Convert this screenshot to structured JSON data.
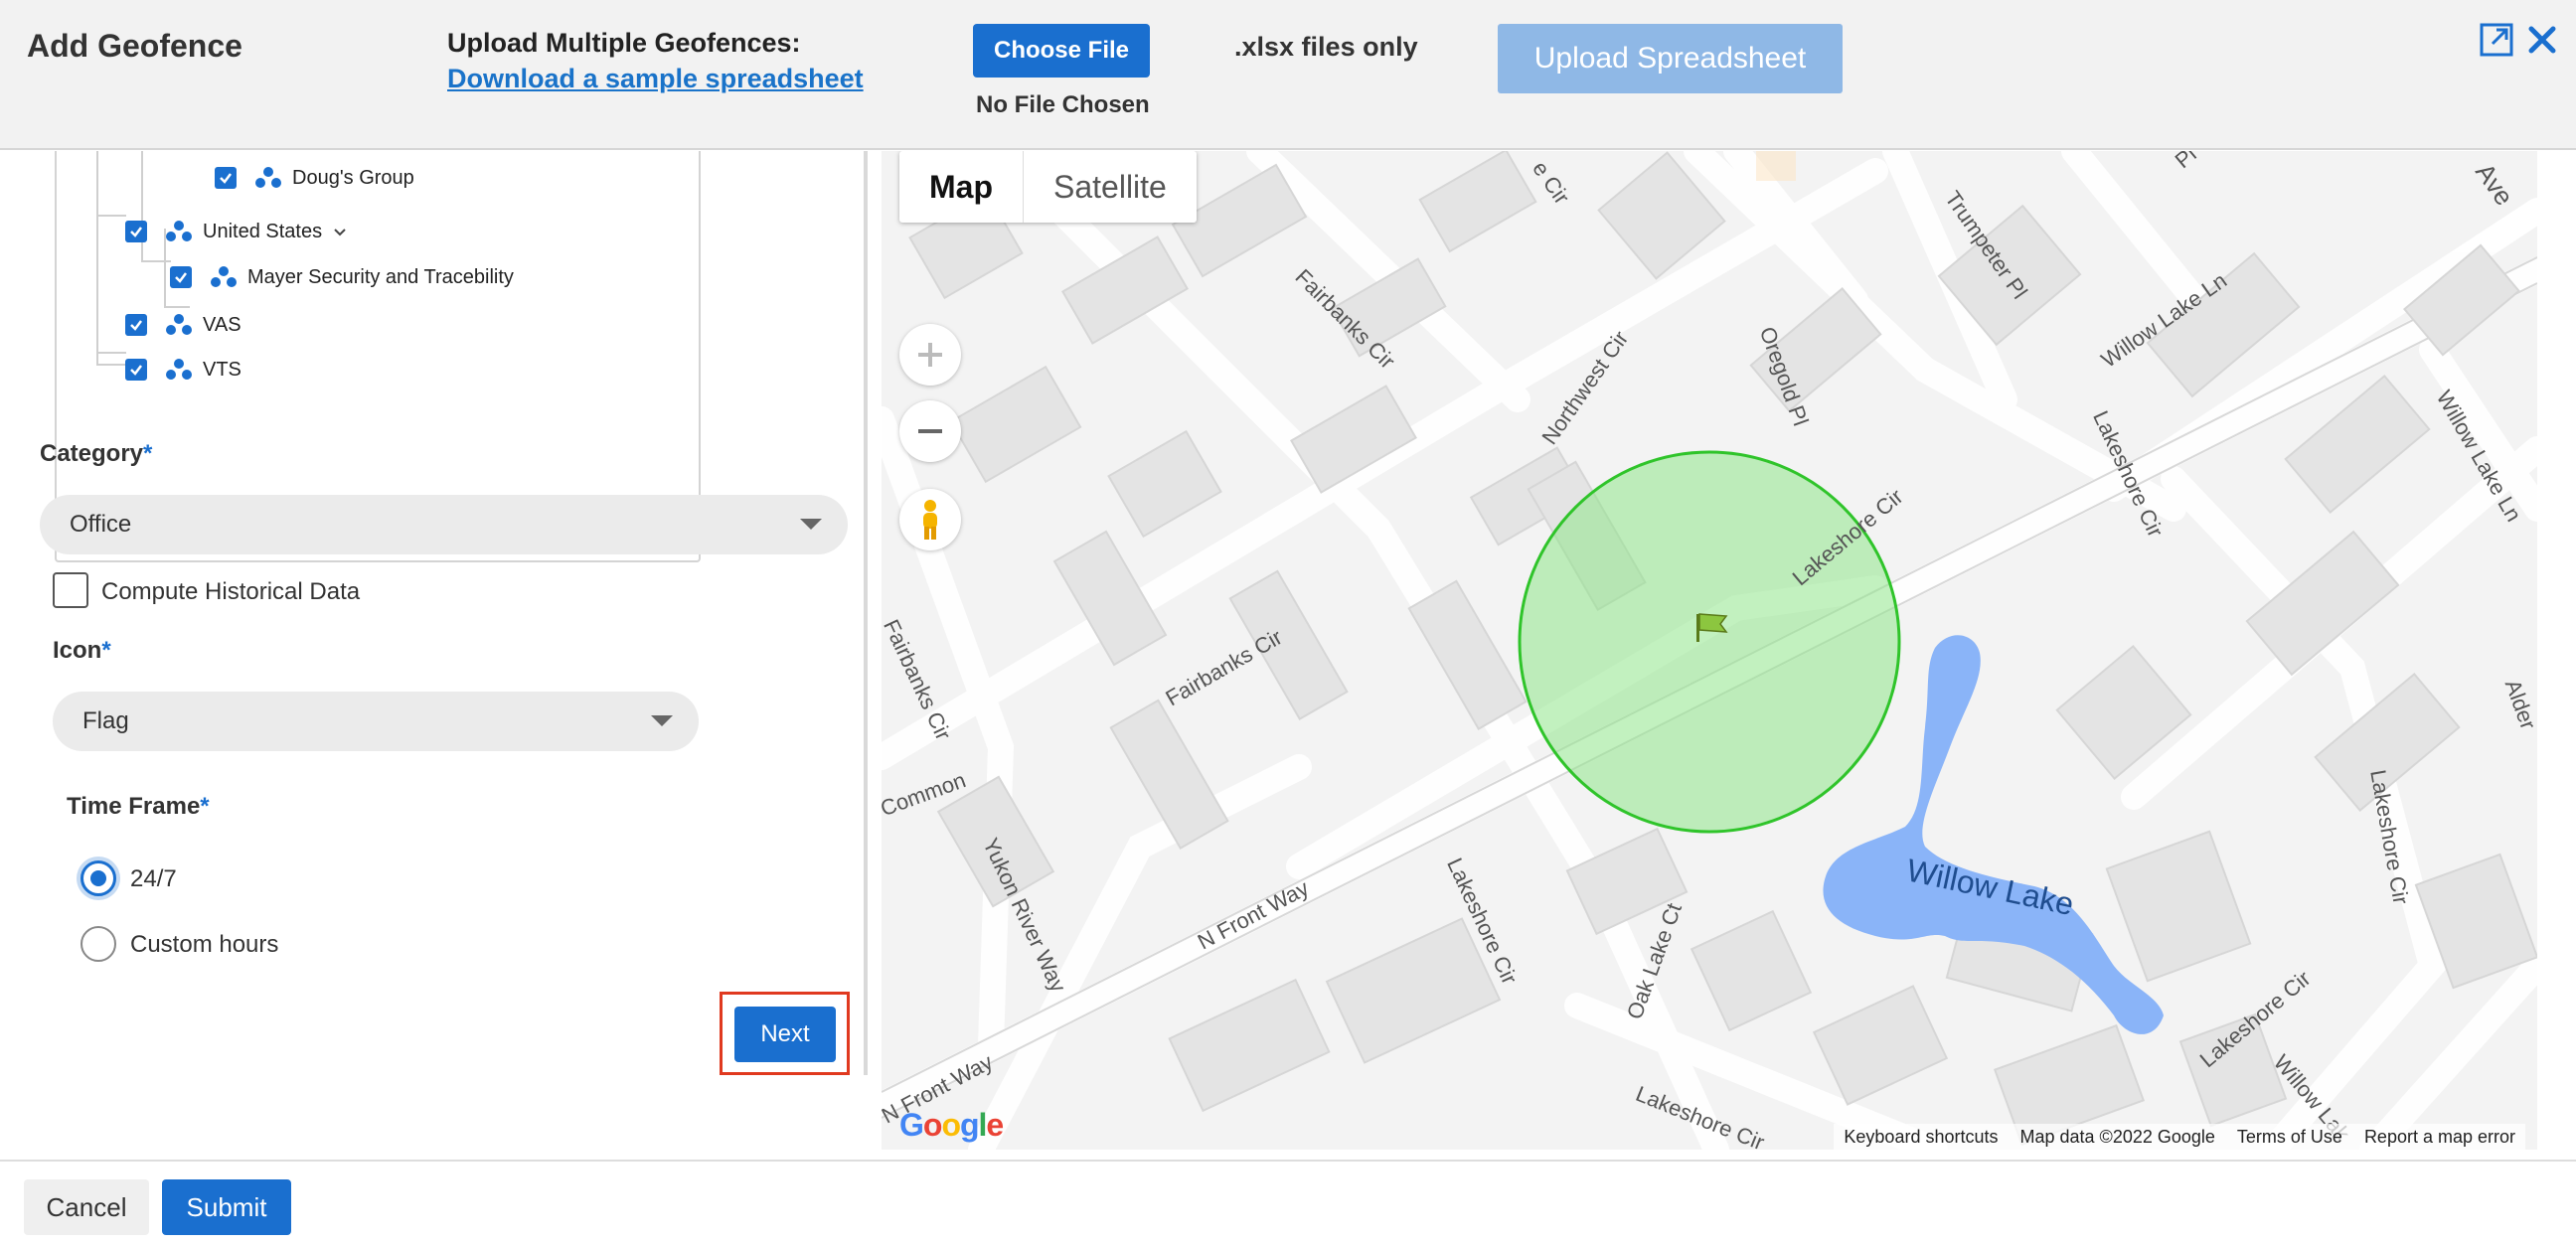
{
  "header": {
    "title": "Add Geofence",
    "upload_label": "Upload Multiple Geofences:",
    "sample_link": "Download a sample spreadsheet",
    "choose_file": "Choose File",
    "no_file": "No File Chosen",
    "xlsx_only": ".xlsx files only",
    "upload_spreadsheet": "Upload Spreadsheet"
  },
  "tree": {
    "items": [
      {
        "label": "Doug's Group",
        "checked": true
      },
      {
        "label": "United States",
        "checked": true,
        "expandable": true
      },
      {
        "label": "Mayer Security and Tracebility",
        "checked": true
      },
      {
        "label": "VAS",
        "checked": true
      },
      {
        "label": "VTS",
        "checked": true
      }
    ]
  },
  "form": {
    "category_label": "Category",
    "category_value": "Office",
    "historical_label": "Compute Historical Data",
    "icon_label": "Icon",
    "icon_value": "Flag",
    "timeframe_label": "Time Frame",
    "required_mark": "*",
    "options": [
      "24/7",
      "Custom hours"
    ],
    "selected_option": "24/7",
    "next": "Next"
  },
  "map": {
    "type_map": "Map",
    "type_satellite": "Satellite",
    "zoom_in": "+",
    "zoom_out": "−",
    "logo": "Google",
    "footer": [
      "Keyboard shortcuts",
      "Map data ©2022 Google",
      "Terms of Use",
      "Report a map error"
    ],
    "streets": [
      "Fairbanks Cir",
      "Northwest Cir",
      "Oregold Pl",
      "Willow Lake Ln",
      "Trumpeter Pl",
      "Lakeshore Cir",
      "Lakeshore Cir",
      "Fairbanks Cir",
      "Fairbanks Cir",
      "Common",
      "Yukon River Way",
      "N Front Way",
      "Lakeshore Cir",
      "Oak Lake Ct",
      "Lakeshore Cir",
      "Lakeshore Cir",
      "N Front Way",
      "Lakeshore Cir",
      "Willow Lake Ln",
      "Willow Lak",
      "Alder",
      "e Cir",
      "Pl",
      "Ave"
    ],
    "lake": "Willow Lake",
    "colors": {
      "geofence_fill": "#8fe58a",
      "geofence_stroke": "#2fc42a",
      "water": "#8ab4f8"
    }
  },
  "footer": {
    "cancel": "Cancel",
    "submit": "Submit"
  },
  "colors": {
    "primary": "#1a6fcf",
    "highlight": "#e0391f"
  }
}
